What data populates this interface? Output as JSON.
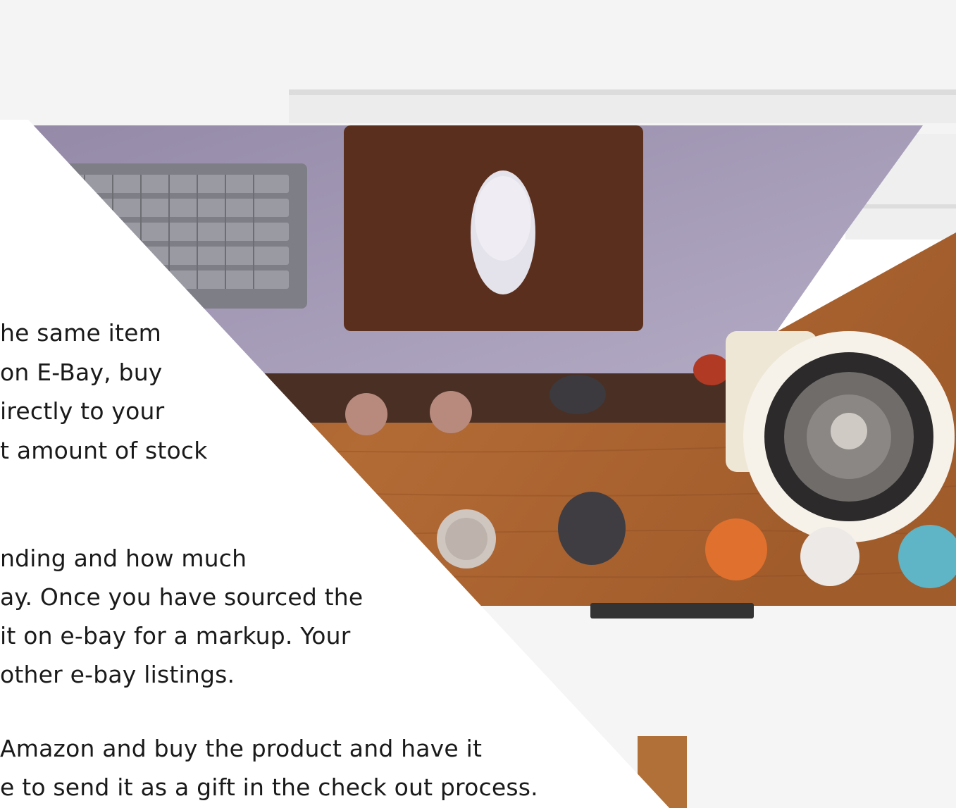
{
  "slide": {
    "text_lines": [
      "he same item",
      "on E-Bay, buy",
      "irectly to your",
      "t amount of stock",
      "nding and how much",
      "ay. Once you have sourced the",
      "it on e-bay for a markup. Your",
      "other e-bay listings.",
      "Amazon and buy the product and have it",
      "e to send it as a gift in the check out process."
    ]
  },
  "photo": {
    "subject": "desk-top-view-photo",
    "colors": {
      "wall": "#f3f3f3",
      "monitor": "#a59cb8",
      "wood": "#b06a34",
      "mousepad": "#5a2e1c",
      "keyboard": "#7d7d85",
      "speaker": "#f5f0e6"
    }
  },
  "theme": {
    "background": "#ffffff",
    "text_color": "#1a1a1a"
  }
}
